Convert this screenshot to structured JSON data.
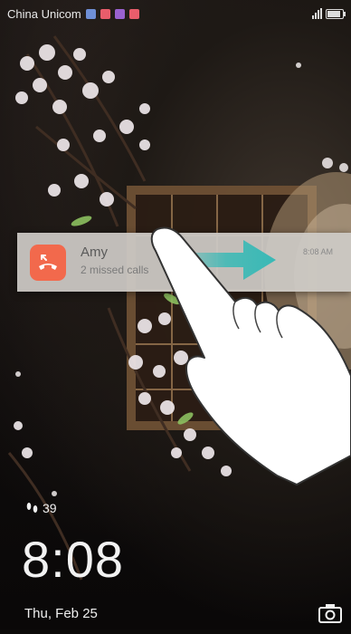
{
  "status_bar": {
    "carrier": "China Unicom",
    "notification_icons": [
      {
        "name": "notification-icon",
        "color": "#6f8fd6"
      },
      {
        "name": "notification-icon",
        "color": "#e85d6b"
      },
      {
        "name": "notification-icon",
        "color": "#9a62d0"
      },
      {
        "name": "notification-icon",
        "color": "#e85d6b"
      }
    ],
    "battery_level": 0.9
  },
  "notification": {
    "app_icon": "missed-call-icon",
    "accent_color": "#f2694c",
    "title": "Amy",
    "body": "2 missed calls",
    "time": "8:08 AM"
  },
  "gesture": {
    "arrow_color": "#39b9b6",
    "hint": "hand-swipe-right-icon"
  },
  "lockscreen": {
    "steps_icon": "footsteps-icon",
    "steps": "39",
    "time": "8:08",
    "date": "Thu, Feb 25",
    "camera_icon": "camera-icon"
  }
}
